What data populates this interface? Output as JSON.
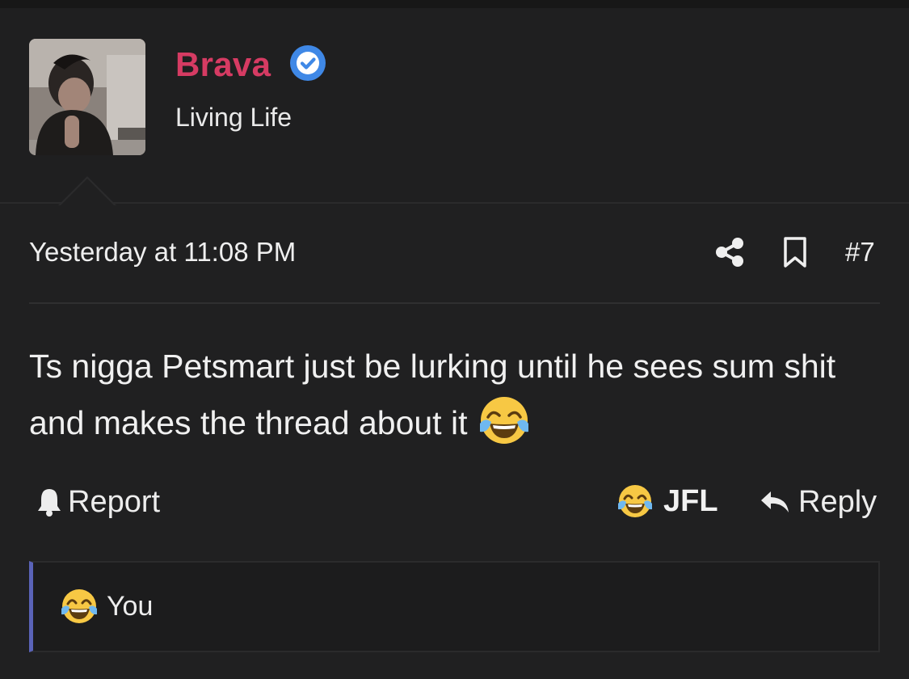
{
  "user": {
    "name": "Brava",
    "title": "Living Life",
    "name_color": "#d63b63",
    "verified": true,
    "verified_color": "#3f88e6"
  },
  "post": {
    "timestamp": "Yesterday at 11:08 PM",
    "number": "#7",
    "message": "Ts nigga Petsmart just be lurking until he sees sum shit and makes the thread about it",
    "message_emoji": "face-with-tears-of-joy"
  },
  "actions": {
    "report_label": "Report",
    "react_label": "JFL",
    "react_emoji": "face-with-tears-of-joy",
    "reply_label": "Reply"
  },
  "reactions": {
    "emoji": "face-with-tears-of-joy",
    "summary": "You"
  },
  "icons": {
    "share": "share-icon",
    "bookmark": "bookmark-icon",
    "report": "bell-icon",
    "reply": "reply-arrow-icon"
  }
}
